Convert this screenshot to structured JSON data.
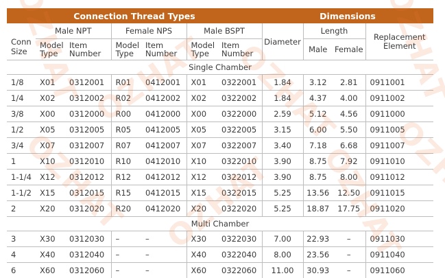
{
  "header": {
    "connection_title": "Connection Thread Types",
    "dimensions_title": "Dimensions",
    "male_npt": "Male NPT",
    "female_nps": "Female NPS",
    "male_bspt": "Male BSPT",
    "length": "Length",
    "conn_size": "Conn Size",
    "model_type": "Model Type",
    "item_number": "Item Number",
    "diameter": "Diameter",
    "male": "Male",
    "female": "Female",
    "replacement": "Replacement Element"
  },
  "sections": {
    "single": "Single Chamber",
    "multi": "Multi Chamber"
  },
  "single_rows": [
    [
      "1/8",
      "X01",
      "0312001",
      "R01",
      "0412001",
      "X01",
      "0322001",
      "1.84",
      "3.12",
      "2.81",
      "0911001"
    ],
    [
      "1/4",
      "X02",
      "0312002",
      "R02",
      "0412002",
      "X02",
      "0322002",
      "1.84",
      "4.37",
      "4.00",
      "0911002"
    ],
    [
      "3/8",
      "X00",
      "0312000",
      "R00",
      "0412000",
      "X00",
      "0322000",
      "2.59",
      "5.12",
      "4.56",
      "0911000"
    ],
    [
      "1/2",
      "X05",
      "0312005",
      "R05",
      "0412005",
      "X05",
      "0322005",
      "3.15",
      "6.00",
      "5.50",
      "0911005"
    ],
    [
      "3/4",
      "X07",
      "0312007",
      "R07",
      "0412007",
      "X07",
      "0322007",
      "3.40",
      "7.18",
      "6.68",
      "0911007"
    ],
    [
      "1",
      "X10",
      "0312010",
      "R10",
      "0412010",
      "X10",
      "0322010",
      "3.90",
      "8.75",
      "7.92",
      "0911010"
    ],
    [
      "1-1/4",
      "X12",
      "0312012",
      "R12",
      "0412012",
      "X12",
      "0322012",
      "3.90",
      "8.75",
      "8.00",
      "0911012"
    ],
    [
      "1-1/2",
      "X15",
      "0312015",
      "R15",
      "0412015",
      "X15",
      "0322015",
      "5.25",
      "13.56",
      "12.50",
      "0911015"
    ],
    [
      "2",
      "X20",
      "0312020",
      "R20",
      "0412020",
      "X20",
      "0322020",
      "5.25",
      "18.87",
      "17.75",
      "0911020"
    ]
  ],
  "multi_rows": [
    [
      "3",
      "X30",
      "0312030",
      "–",
      "–",
      "X30",
      "0322030",
      "7.00",
      "22.93",
      "–",
      "0911030"
    ],
    [
      "4",
      "X40",
      "0312040",
      "–",
      "–",
      "X40",
      "0322040",
      "8.00",
      "23.56",
      "–",
      "0911040"
    ],
    [
      "6",
      "X60",
      "0312060",
      "–",
      "–",
      "X60",
      "0322060",
      "11.00",
      "30.93",
      "–",
      "0911060"
    ]
  ],
  "watermark": "OZHAT",
  "colors": {
    "band": "#c0651b",
    "grid": "#bdbdbd",
    "text": "#3a3a3a"
  }
}
